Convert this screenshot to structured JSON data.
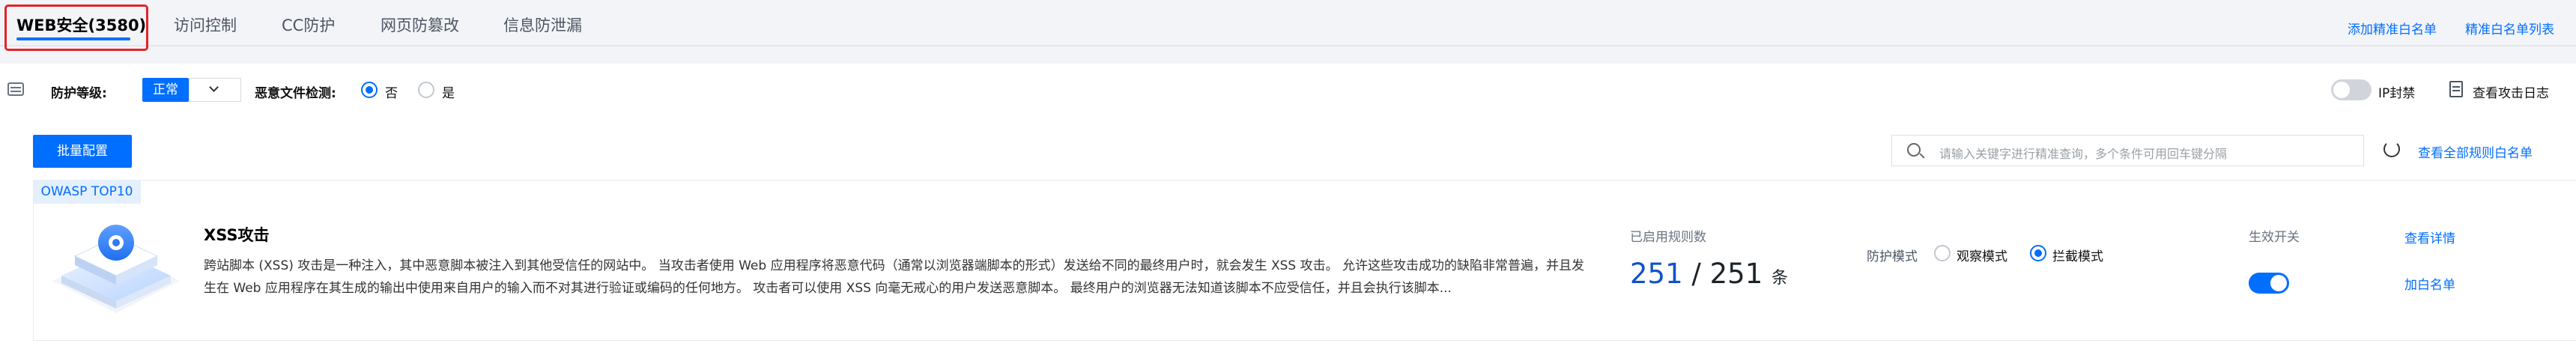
{
  "tabs": [
    {
      "label": "WEB安全(3580)",
      "active": true
    },
    {
      "label": "访问控制",
      "active": false
    },
    {
      "label": "CC防护",
      "active": false
    },
    {
      "label": "网页防篡改",
      "active": false
    },
    {
      "label": "信息防泄漏",
      "active": false
    }
  ],
  "top_links": {
    "add_whitelist": "添加精准白名单",
    "whitelist_list": "精准白名单列表"
  },
  "settings": {
    "protect_level_label": "防护等级:",
    "protect_level_value": "正常",
    "malicious_file_label": "恶意文件检测:",
    "radio_no": "否",
    "radio_yes": "是",
    "selected": "否",
    "ip_block_label": "IP封禁",
    "ip_block_on": false,
    "view_logs_label": "查看攻击日志"
  },
  "toolbar": {
    "batch_config_label": "批量配置",
    "search_placeholder": "请输入关键字进行精准查询，多个条件可用回车键分隔",
    "view_all_whitelist": "查看全部规则白名单"
  },
  "rule_card": {
    "badge": "OWASP TOP10",
    "title": "XSS攻击",
    "description": "跨站脚本 (XSS) 攻击是一种注入，其中恶意脚本被注入到其他受信任的网站中。 当攻击者使用 Web 应用程序将恶意代码（通常以浏览器端脚本的形式）发送给不同的最终用户时，就会发生 XSS 攻击。 允许这些攻击成功的缺陷非常普遍，并且发生在 Web 应用程序在其生成的输出中使用来自用户的输入而不对其进行验证或编码的任何地方。 攻击者可以使用 XSS 向毫无戒心的用户发送恶意脚本。 最终用户的浏览器无法知道该脚本不应受信任，并且会执行该脚本...",
    "enabled_rules_label": "已启用规则数",
    "enabled_count": "251",
    "separator": "/",
    "total_count": "251",
    "unit": "条",
    "mode_label": "防护模式",
    "mode_observe": "观察模式",
    "mode_block": "拦截模式",
    "mode_selected": "拦截模式",
    "switch_label": "生效开关",
    "switch_on": true,
    "view_details": "查看详情",
    "add_whitelist": "加白名单"
  },
  "colors": {
    "accent": "#006eff",
    "highlight_border": "#e3242b",
    "count_blue": "#1052c9"
  }
}
